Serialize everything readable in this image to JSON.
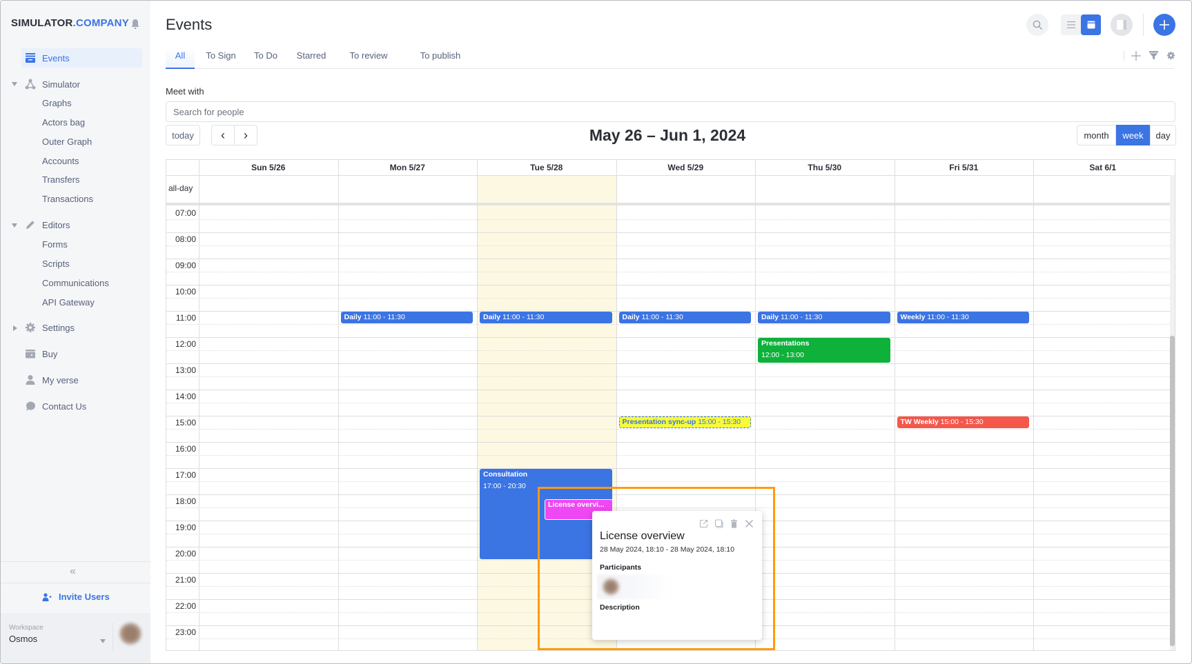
{
  "app": {
    "logo_main": "SIMULATOR",
    "logo_accent": ".COMPANY"
  },
  "sidebar": {
    "active": "Events",
    "items": [
      {
        "label": "Events",
        "icon": "events-calendar-icon"
      },
      {
        "label": "Simulator",
        "icon": "graph-nodes-icon",
        "expanded": true,
        "children": [
          "Graphs",
          "Actors bag",
          "Outer Graph",
          "Accounts",
          "Transfers",
          "Transactions"
        ]
      },
      {
        "label": "Editors",
        "icon": "pencil-icon",
        "expanded": true,
        "children": [
          "Forms",
          "Scripts",
          "Communications",
          "API Gateway"
        ]
      },
      {
        "label": "Settings",
        "icon": "gear-icon",
        "expanded": false
      },
      {
        "label": "Buy",
        "icon": "wallet-icon"
      },
      {
        "label": "My verse",
        "icon": "user-icon"
      },
      {
        "label": "Contact Us",
        "icon": "chat-bubble-icon"
      }
    ],
    "collapse_label": "«",
    "invite_label": "Invite Users",
    "workspace_label": "Workspace",
    "workspace_value": "Osmos"
  },
  "header": {
    "title": "Events",
    "tabs": [
      "All",
      "To Sign",
      "To Do",
      "Starred",
      "To review",
      "To publish"
    ],
    "active_tab": "All",
    "view_mode": "calendar"
  },
  "filters": {
    "meet_with_label": "Meet with",
    "search_placeholder": "Search for people"
  },
  "calendar": {
    "today_label": "today",
    "prev_label": "‹",
    "next_label": "›",
    "range_title": "May 26 – Jun 1, 2024",
    "views": [
      "month",
      "week",
      "day"
    ],
    "active_view": "week",
    "allday_label": "all-day",
    "days": [
      "Sun 5/26",
      "Mon 5/27",
      "Tue 5/28",
      "Wed 5/29",
      "Thu 5/30",
      "Fri 5/31",
      "Sat 6/1"
    ],
    "today_index": 2,
    "hours": [
      "07:00",
      "08:00",
      "09:00",
      "10:00",
      "11:00",
      "12:00",
      "13:00",
      "14:00",
      "15:00",
      "16:00",
      "17:00",
      "18:00",
      "19:00",
      "20:00",
      "21:00",
      "22:00",
      "23:00"
    ],
    "events": [
      {
        "day": 1,
        "title": "Daily",
        "time": "11:00 - 11:30",
        "start": 11.0,
        "end": 11.5,
        "color": "#3b74e3",
        "text_color": "#ffffff"
      },
      {
        "day": 2,
        "title": "Daily",
        "time": "11:00 - 11:30",
        "start": 11.0,
        "end": 11.5,
        "color": "#3b74e3",
        "text_color": "#ffffff"
      },
      {
        "day": 3,
        "title": "Daily",
        "time": "11:00 - 11:30",
        "start": 11.0,
        "end": 11.5,
        "color": "#3b74e3",
        "text_color": "#ffffff"
      },
      {
        "day": 4,
        "title": "Daily",
        "time": "11:00 - 11:30",
        "start": 11.0,
        "end": 11.5,
        "color": "#3b74e3",
        "text_color": "#ffffff"
      },
      {
        "day": 5,
        "title": "Weekly",
        "time": "11:00 - 11:30",
        "start": 11.0,
        "end": 11.5,
        "color": "#3b74e3",
        "text_color": "#ffffff"
      },
      {
        "day": 4,
        "title": "Presentations",
        "time": "12:00 - 13:00",
        "start": 12.0,
        "end": 13.0,
        "color": "#0eb13a",
        "text_color": "#ffffff",
        "stacked": true
      },
      {
        "day": 3,
        "title": "Presentation sync-up",
        "time": "15:00 - 15:30",
        "start": 15.0,
        "end": 15.5,
        "color": "#f8fb3a",
        "text_color": "#3b74e3"
      },
      {
        "day": 5,
        "title": "TW Weekly",
        "time": "15:00 - 15:30",
        "start": 15.0,
        "end": 15.5,
        "color": "#f5574b",
        "text_color": "#ffffff"
      },
      {
        "day": 2,
        "title": "Consultation",
        "time": "17:00 - 20:30",
        "start": 17.0,
        "end": 20.5,
        "color": "#3b74e3",
        "text_color": "#ffffff",
        "stacked": true
      },
      {
        "day": 2,
        "title": "License overvi...",
        "time": "",
        "start": 18.17,
        "end": 19.0,
        "color": "#f047f5",
        "text_color": "#ffffff",
        "inset": true
      }
    ]
  },
  "popover": {
    "title": "License overview",
    "time": "28 May 2024, 18:10 - 28 May 2024, 18:10",
    "participants_label": "Participants",
    "description_label": "Description",
    "actions": [
      "open-external-icon",
      "duplicate-icon",
      "trash-icon",
      "close-icon"
    ]
  },
  "colors": {
    "accent": "#3b74e3",
    "today_bg": "#fdf8e2",
    "highlight": "#ff9a0a"
  }
}
